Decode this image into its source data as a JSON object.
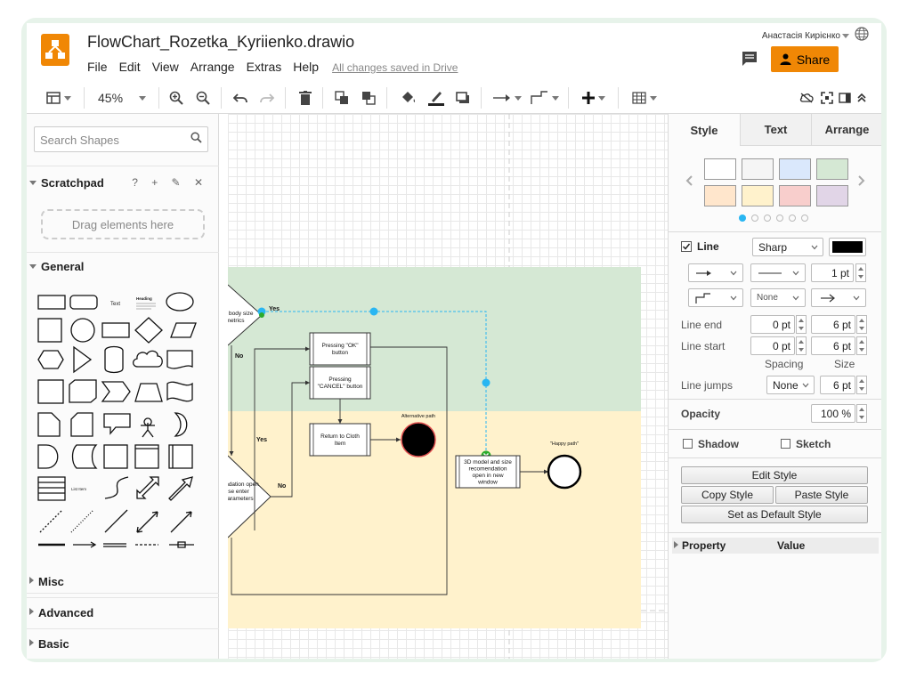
{
  "app": {
    "title": "FlowChart_Rozetka_Kyriienko.drawio",
    "menu": [
      "File",
      "Edit",
      "View",
      "Arrange",
      "Extras",
      "Help"
    ],
    "saved_status": "All changes saved in Drive",
    "user_name": "Анастасія Кирієнко",
    "share_label": "Share",
    "accent_color": "#f08705"
  },
  "toolbar": {
    "zoom": "45%",
    "icons": [
      "panel-layout-icon",
      "zoom-in-icon",
      "zoom-out-icon",
      "undo-icon",
      "redo-icon",
      "delete-icon",
      "to-front-icon",
      "to-back-icon",
      "fill-color-icon",
      "line-color-icon",
      "shadow-icon",
      "connection-icon",
      "waypoint-icon",
      "insert-icon",
      "table-icon",
      "unlink-icon",
      "fit-icon",
      "format-panel-icon",
      "collapse-icon"
    ]
  },
  "left_panel": {
    "search_placeholder": "Search Shapes",
    "scratchpad_title": "Scratchpad",
    "scratchpad_tools": "? + ✎ ✕",
    "dropzone_text": "Drag elements here",
    "general_title": "General",
    "shape_text_label": "Text",
    "shape_heading_label": "Heading",
    "shape_list_label": "List Item",
    "collapsed_sections": [
      "Misc",
      "Advanced",
      "Basic"
    ]
  },
  "diagram": {
    "labels": {
      "body_size": "...4 body size\nmetrics",
      "yes_top": "Yes",
      "no_left": "No",
      "pressing_ok": "Pressing \"OK\"\nbutton",
      "pressing_cancel": "Pressing\n\"CANCEL\" button",
      "return_cloth": "Return to Cloth\nItem",
      "alternative_path": "Alternative path",
      "recommendation": "...ndation open\n...se enter\n...arameters",
      "yes_mid": "Yes",
      "no_mid": "No",
      "model_3d": "3D model and size\nrecomendation\nopen in new\nwindow",
      "happy_path": "\"Happy path\""
    },
    "lane_colors": [
      "#d5e8d4",
      "#fff2cc"
    ]
  },
  "right_panel": {
    "tabs": [
      "Style",
      "Text",
      "Arrange"
    ],
    "swatch_colors": [
      "#ffffff",
      "#f5f5f5",
      "#dae8fc",
      "#d5e8d4",
      "#ffe6cc",
      "#fff2cc",
      "#f8cecc",
      "#e1d5e7"
    ],
    "line_label": "Line",
    "line_style": "Sharp",
    "line_color": "#000000",
    "line_width": "1 pt",
    "line_none": "None",
    "line_end_label": "Line end",
    "line_start_label": "Line start",
    "line_end_spacing": "0 pt",
    "line_end_size": "6 pt",
    "line_start_spacing": "0 pt",
    "line_start_size": "6 pt",
    "spacing_label": "Spacing",
    "size_label": "Size",
    "line_jumps_label": "Line jumps",
    "line_jumps_value": "None",
    "line_jumps_size": "6 pt",
    "opacity_label": "Opacity",
    "opacity_value": "100 %",
    "shadow_label": "Shadow",
    "sketch_label": "Sketch",
    "edit_style": "Edit Style",
    "copy_style": "Copy Style",
    "paste_style": "Paste Style",
    "set_default_style": "Set as Default Style",
    "property_header": "Property",
    "value_header": "Value"
  }
}
